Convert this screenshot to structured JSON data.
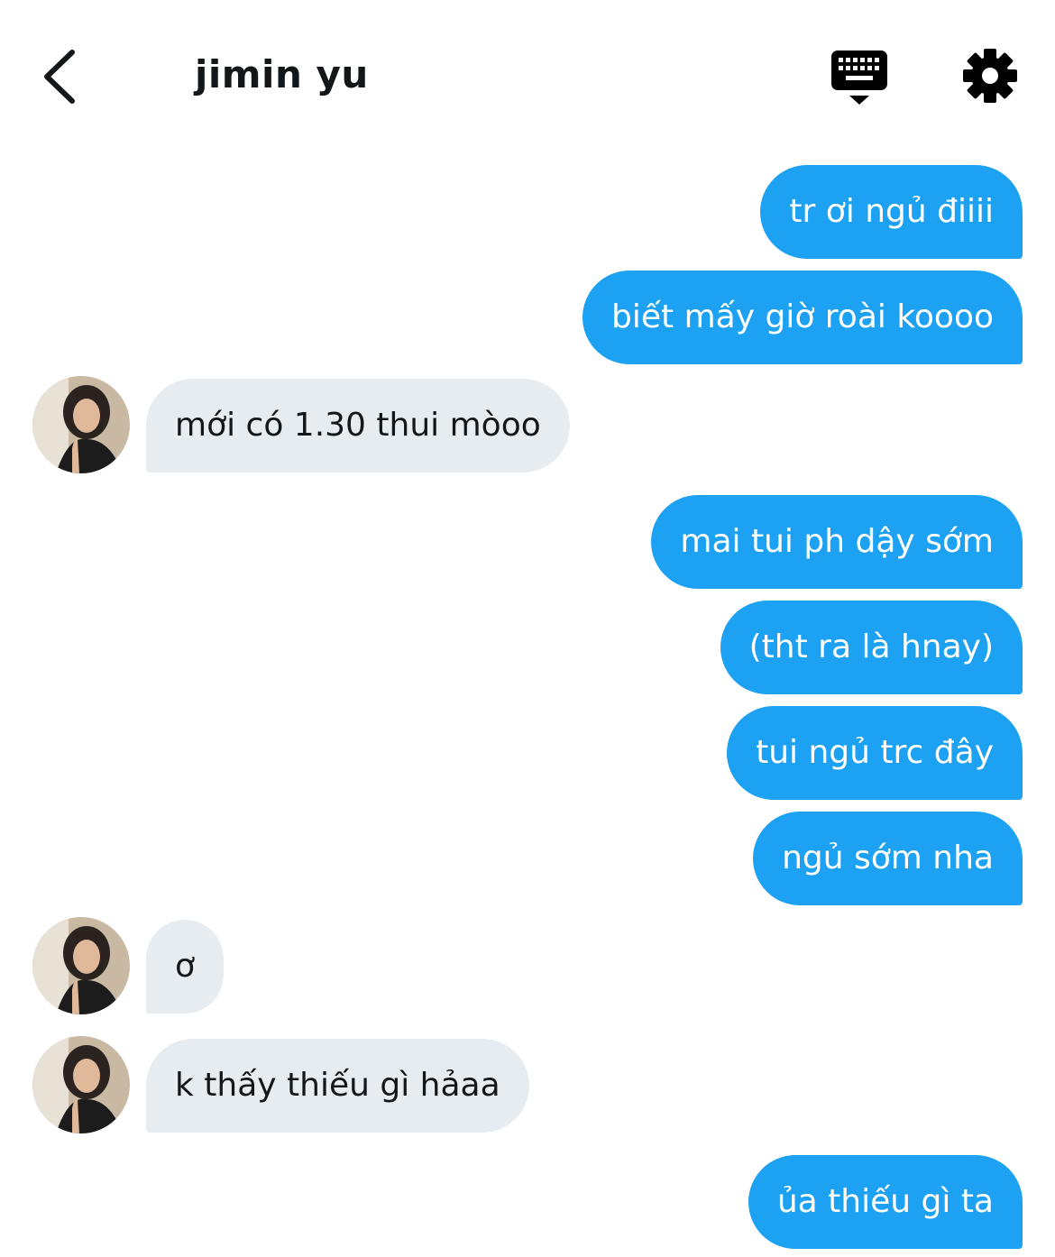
{
  "header": {
    "contact_name": "jimin yu"
  },
  "icons": {
    "back": "chevron-left-icon",
    "keyboard": "keyboard-icon",
    "settings": "gear-icon"
  },
  "colors": {
    "outgoing_bubble": "#1da1f2",
    "incoming_bubble": "#e6ecf0",
    "text_dark": "#14171a"
  },
  "messages": [
    {
      "direction": "out",
      "text": "tr ơi ngủ điiii"
    },
    {
      "direction": "out",
      "text": "biết mấy giờ roài koooo"
    },
    {
      "direction": "in",
      "text": "mới có 1.30 thui mòoo"
    },
    {
      "direction": "out",
      "text": "mai tui ph dậy sớm"
    },
    {
      "direction": "out",
      "text": "(tht ra là hnay)"
    },
    {
      "direction": "out",
      "text": "tui ngủ trc đây"
    },
    {
      "direction": "out",
      "text": "ngủ sớm nha"
    },
    {
      "direction": "in",
      "text": "ơ"
    },
    {
      "direction": "in",
      "text": "k thấy thiếu gì hảaa"
    },
    {
      "direction": "out",
      "text": "ủa thiếu gì ta"
    }
  ]
}
